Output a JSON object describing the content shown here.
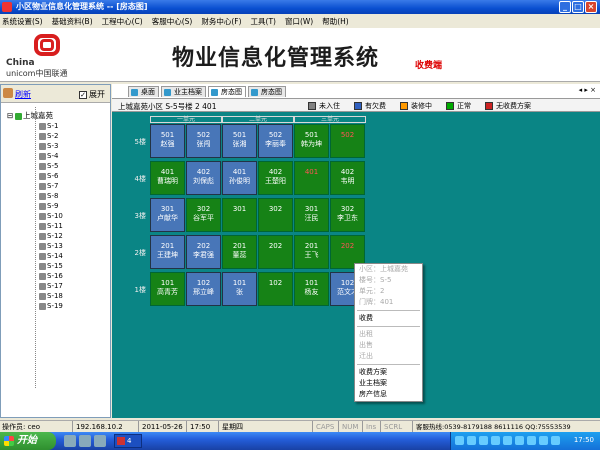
{
  "window": {
    "title": "小区物业信息化管理系统 -- [房态图]"
  },
  "menu": [
    "系统设置(S)",
    "基础资料(B)",
    "工程中心(C)",
    "客服中心(S)",
    "财务中心(F)",
    "工具(T)",
    "窗口(W)",
    "帮助(H)"
  ],
  "banner": {
    "logo_line1": "China",
    "logo_line2": "unicom中国联通",
    "system_name": "物业信息化管理系统",
    "client_label": "收费端"
  },
  "sidebar": {
    "refresh_label": "刷新",
    "expand_label": "展开",
    "expand_checked": true,
    "root_label": "上城嘉苑",
    "buildings": [
      "S-1",
      "S-2",
      "S-3",
      "S-4",
      "S-5",
      "S-6",
      "S-7",
      "S-8",
      "S-9",
      "S-10",
      "S-11",
      "S-12",
      "S-13",
      "S-14",
      "S-15",
      "S-16",
      "S-17",
      "S-18",
      "S-19"
    ]
  },
  "tabs": [
    "桌面",
    "业主档案",
    "房态图",
    "房态图"
  ],
  "active_tab": 2,
  "location": "上城嘉苑小区  S-5号楼  2  401",
  "legend": [
    {
      "label": "未入住",
      "color": "#808080"
    },
    {
      "label": "有欠费",
      "color": "#3060c0"
    },
    {
      "label": "装修中",
      "color": "#ff9900"
    },
    {
      "label": "正常",
      "color": "#00aa00"
    },
    {
      "label": "无收费方案",
      "color": "#cc2222"
    }
  ],
  "unit_headers": [
    "一单元",
    "二单元",
    "三单元"
  ],
  "floors": [
    "5楼",
    "4楼",
    "3楼",
    "2楼",
    "1楼"
  ],
  "rooms": {
    "f5": [
      {
        "no": "501",
        "owner": "赵强",
        "status": "blue"
      },
      {
        "no": "502",
        "owner": "张闯",
        "status": "blue"
      },
      {
        "no": "501",
        "owner": "张湘",
        "status": "blue"
      },
      {
        "no": "502",
        "owner": "李丽奉",
        "status": "blue"
      },
      {
        "no": "501",
        "owner": "韩为坤",
        "status": "green"
      },
      {
        "no": "502",
        "owner": "",
        "status": "red"
      }
    ],
    "f4": [
      {
        "no": "401",
        "owner": "曹瑞明",
        "status": "green"
      },
      {
        "no": "402",
        "owner": "刘保彪",
        "status": "blue"
      },
      {
        "no": "401",
        "owner": "孙俊明",
        "status": "blue"
      },
      {
        "no": "402",
        "owner": "王楚阳",
        "status": "green"
      },
      {
        "no": "401",
        "owner": "",
        "status": "red"
      },
      {
        "no": "402",
        "owner": "韦明",
        "status": "green"
      }
    ],
    "f3": [
      {
        "no": "301",
        "owner": "卢献华",
        "status": "blue"
      },
      {
        "no": "302",
        "owner": "谷军平",
        "status": "green"
      },
      {
        "no": "301",
        "owner": "",
        "status": "green"
      },
      {
        "no": "302",
        "owner": "",
        "status": "green"
      },
      {
        "no": "301",
        "owner": "汪民",
        "status": "green"
      },
      {
        "no": "302",
        "owner": "李卫东",
        "status": "green"
      }
    ],
    "f2": [
      {
        "no": "201",
        "owner": "王建坤",
        "status": "blue"
      },
      {
        "no": "202",
        "owner": "李君强",
        "status": "blue"
      },
      {
        "no": "201",
        "owner": "董蕊",
        "status": "green"
      },
      {
        "no": "202",
        "owner": "",
        "status": "green"
      },
      {
        "no": "201",
        "owner": "王飞",
        "status": "green"
      },
      {
        "no": "202",
        "owner": "",
        "status": "red"
      }
    ],
    "f1": [
      {
        "no": "101",
        "owner": "高青芳",
        "status": "green"
      },
      {
        "no": "102",
        "owner": "邢立峰",
        "status": "blue"
      },
      {
        "no": "101",
        "owner": "张",
        "status": "blue"
      },
      {
        "no": "102",
        "owner": "",
        "status": "green"
      },
      {
        "no": "101",
        "owner": "杨友",
        "status": "green"
      },
      {
        "no": "102",
        "owner": "范文才",
        "status": "blue"
      }
    ]
  },
  "context_menu": {
    "info": [
      "小区：上城嘉苑",
      "楼号：S-5",
      "单元：2",
      "门牌：401"
    ],
    "items": [
      "收费"
    ],
    "disabled": [
      "出租",
      "出售",
      "迁出"
    ],
    "items2": [
      "收费方案",
      "业主档案",
      "房产信息"
    ]
  },
  "status": {
    "operator": "操作员: ceo",
    "ip": "192.168.10.2",
    "date": "2011-05-26",
    "time": "17:50",
    "weekday": "星期四",
    "caps": "CAPS",
    "num": "NUM",
    "ins": "Ins",
    "scrl": "SCRL",
    "hotline": "客服热线:0539-8179188 8611116 QQ:75553539"
  },
  "taskbar": {
    "start_label": "开始",
    "task_label": "4",
    "clock": "17:50"
  }
}
